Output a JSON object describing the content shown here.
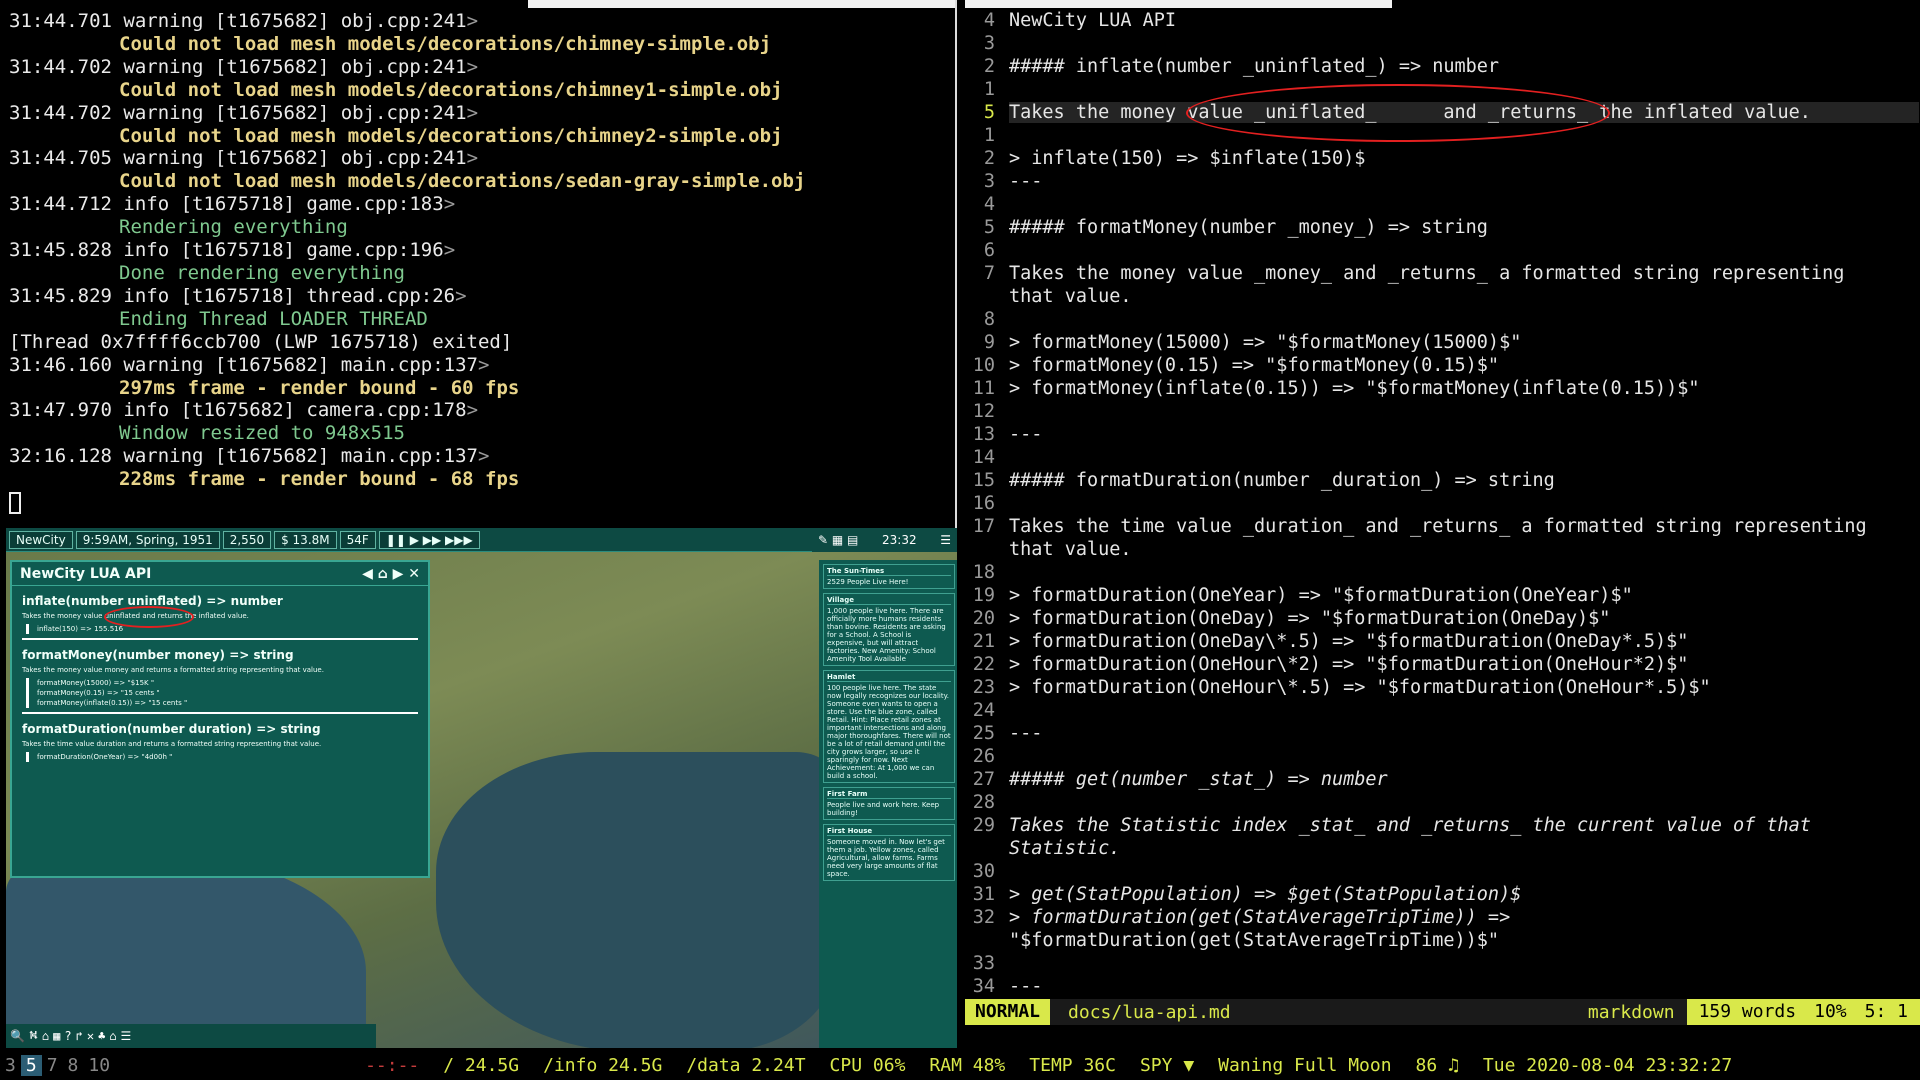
{
  "terminal": {
    "lines": [
      {
        "head": "31:44.701 warning [t1675682] obj.cpp:241",
        "arrow": ">",
        "msg": "Could not load mesh models/decorations/chimney-simple.obj",
        "kind": "warn"
      },
      {
        "head": "31:44.702 warning [t1675682] obj.cpp:241",
        "arrow": ">",
        "msg": "Could not load mesh models/decorations/chimney1-simple.obj",
        "kind": "warn"
      },
      {
        "head": "31:44.702 warning [t1675682] obj.cpp:241",
        "arrow": ">",
        "msg": "Could not load mesh models/decorations/chimney2-simple.obj",
        "kind": "warn"
      },
      {
        "head": "31:44.705 warning [t1675682] obj.cpp:241",
        "arrow": ">",
        "msg": "Could not load mesh models/decorations/sedan-gray-simple.obj",
        "kind": "warn"
      },
      {
        "head": "31:44.712 info [t1675718] game.cpp:183",
        "arrow": ">",
        "msg": "Rendering everything",
        "kind": "info"
      },
      {
        "head": "31:45.828 info [t1675718] game.cpp:196",
        "arrow": ">",
        "msg": "Done rendering everything",
        "kind": "info"
      },
      {
        "head": "31:45.829 info [t1675718] thread.cpp:26",
        "arrow": ">",
        "msg": "Ending Thread LOADER THREAD",
        "kind": "info"
      },
      {
        "head": "[Thread 0x7ffff6ccb700 (LWP 1675718) exited]",
        "arrow": "",
        "msg": "",
        "kind": "plain"
      },
      {
        "head": "31:46.160 warning [t1675682] main.cpp:137",
        "arrow": ">",
        "msg": "297ms frame - render bound - 60 fps",
        "kind": "warn"
      },
      {
        "head": "31:47.970 info [t1675682] camera.cpp:178",
        "arrow": ">",
        "msg": "Window resized to 948x515",
        "kind": "info"
      },
      {
        "head": "32:16.128 warning [t1675682] main.cpp:137",
        "arrow": ">",
        "msg": "228ms frame - render bound - 68 fps",
        "kind": "warn"
      }
    ]
  },
  "game": {
    "city_name": "NewCity",
    "datetime": "9:59AM, Spring, 1951",
    "population": "2,550",
    "money": "$ 13.8M",
    "weather": "54F",
    "clock": "23:32",
    "lua_window": {
      "title": "NewCity LUA API",
      "h1": "inflate(number uninflated) => number",
      "s1": "Takes the money value uninflated and returns the inflated value.",
      "c1": "inflate(150) => 155.516",
      "h2": "formatMoney(number money) => string",
      "s2": "Takes the money value money and returns a formatted string representing that value.",
      "c2a": "formatMoney(15000) => \"$15K \"",
      "c2b": "formatMoney(0.15) => \"15 cents \"",
      "c2c": "formatMoney(inflate(0.15)) => \"15 cents \"",
      "h3": "formatDuration(number duration) => string",
      "s3": "Takes the time value duration and returns a formatted string representing that value.",
      "c3": "formatDuration(OneYear) => \"4d00h \""
    },
    "news": {
      "header": "The Sun-Times",
      "sub": "2529 People Live Here!",
      "cards": [
        {
          "title": "Village",
          "body": "1,000 people live here. There are officially more humans residents than bovine. Residents are asking for a School. A School is expensive, but will attract factories. New Amenity: School Amenity Tool Available"
        },
        {
          "title": "Hamlet",
          "body": "100 people live here. The state now legally recognizes our locality. Someone even wants to open a store. Use the blue zone, called Retail. Hint: Place retail zones at important intersections and along major thoroughfares. There will not be a lot of retail demand until the city grows larger, so use it sparingly for now. Next Achievement: At 1,000 we can build a school."
        },
        {
          "title": "First Farm",
          "body": "People live and work here. Keep building!"
        },
        {
          "title": "First House",
          "body": "Someone moved in. Now let's get them a job. Yellow zones, called Agricultural, allow farms. Farms need very large amounts of flat space."
        }
      ]
    }
  },
  "editor": {
    "lines": [
      {
        "n": "4",
        "t": "NewCity LUA API"
      },
      {
        "n": "3",
        "t": ""
      },
      {
        "n": "2",
        "t": "##### inflate(number _uninflated_) => number"
      },
      {
        "n": "1",
        "t": ""
      },
      {
        "n": "5",
        "t": "Takes the money value _uniflated_      and _returns_ the inflated value."
      },
      {
        "n": "1",
        "t": ""
      },
      {
        "n": "2",
        "t": "> inflate(150) => $inflate(150)$"
      },
      {
        "n": "3",
        "t": "---"
      },
      {
        "n": "4",
        "t": ""
      },
      {
        "n": "5",
        "t": "##### formatMoney(number _money_) => string"
      },
      {
        "n": "6",
        "t": ""
      },
      {
        "n": "7",
        "t": "Takes the money value _money_ and _returns_ a formatted string representing"
      },
      {
        "n": "",
        "t": "that value."
      },
      {
        "n": "8",
        "t": ""
      },
      {
        "n": "9",
        "t": "> formatMoney(15000) => \"$formatMoney(15000)$\""
      },
      {
        "n": "10",
        "t": "> formatMoney(0.15) => \"$formatMoney(0.15)$\""
      },
      {
        "n": "11",
        "t": "> formatMoney(inflate(0.15)) => \"$formatMoney(inflate(0.15))$\""
      },
      {
        "n": "12",
        "t": ""
      },
      {
        "n": "13",
        "t": "---"
      },
      {
        "n": "14",
        "t": ""
      },
      {
        "n": "15",
        "t": "##### formatDuration(number _duration_) => string"
      },
      {
        "n": "16",
        "t": ""
      },
      {
        "n": "17",
        "t": "Takes the time value _duration_ and _returns_ a formatted string representing"
      },
      {
        "n": "",
        "t": "that value."
      },
      {
        "n": "18",
        "t": ""
      },
      {
        "n": "19",
        "t": "> formatDuration(OneYear) => \"$formatDuration(OneYear)$\""
      },
      {
        "n": "20",
        "t": "> formatDuration(OneDay) => \"$formatDuration(OneDay)$\""
      },
      {
        "n": "21",
        "t": "> formatDuration(OneDay\\*.5) => \"$formatDuration(OneDay*.5)$\""
      },
      {
        "n": "22",
        "t": "> formatDuration(OneHour\\*2) => \"$formatDuration(OneHour*2)$\""
      },
      {
        "n": "23",
        "t": "> formatDuration(OneHour\\*.5) => \"$formatDuration(OneHour*.5)$\""
      },
      {
        "n": "24",
        "t": ""
      },
      {
        "n": "25",
        "t": "---"
      },
      {
        "n": "26",
        "t": ""
      },
      {
        "n": "27",
        "t": "##### get(number _stat_) => number"
      },
      {
        "n": "28",
        "t": ""
      },
      {
        "n": "29",
        "t": "Takes the Statistic index _stat_ and _returns_ the current value of that"
      },
      {
        "n": "",
        "t": "Statistic."
      },
      {
        "n": "30",
        "t": ""
      },
      {
        "n": "31",
        "t": "> get(StatPopulation) => $get(StatPopulation)$"
      },
      {
        "n": "32",
        "t": "> formatDuration(get(StatAverageTripTime)) =>"
      },
      {
        "n": "",
        "t": "\"$formatDuration(get(StatAverageTripTime))$\""
      },
      {
        "n": "33",
        "t": ""
      },
      {
        "n": "34",
        "t": "---"
      }
    ],
    "status": {
      "mode": "NORMAL",
      "file": "docs/lua-api.md",
      "filetype": "markdown",
      "words": "159 words",
      "percent": "10%",
      "position": "5:  1"
    }
  },
  "taskbar": {
    "workspaces": [
      "3",
      "5",
      "7",
      "8",
      "10"
    ],
    "active": "5",
    "load": "--:--",
    "root": "/ 24.5G",
    "info": "/info 24.5G",
    "data": "/data 2.24T",
    "cpu": "CPU 06%",
    "ram": "RAM 48%",
    "temp": "TEMP 36C",
    "spy": "SPY ▼",
    "moon": "Waning Full Moon",
    "volume": "86 ♫",
    "datetime": "Tue 2020-08-04 23:32:27"
  }
}
